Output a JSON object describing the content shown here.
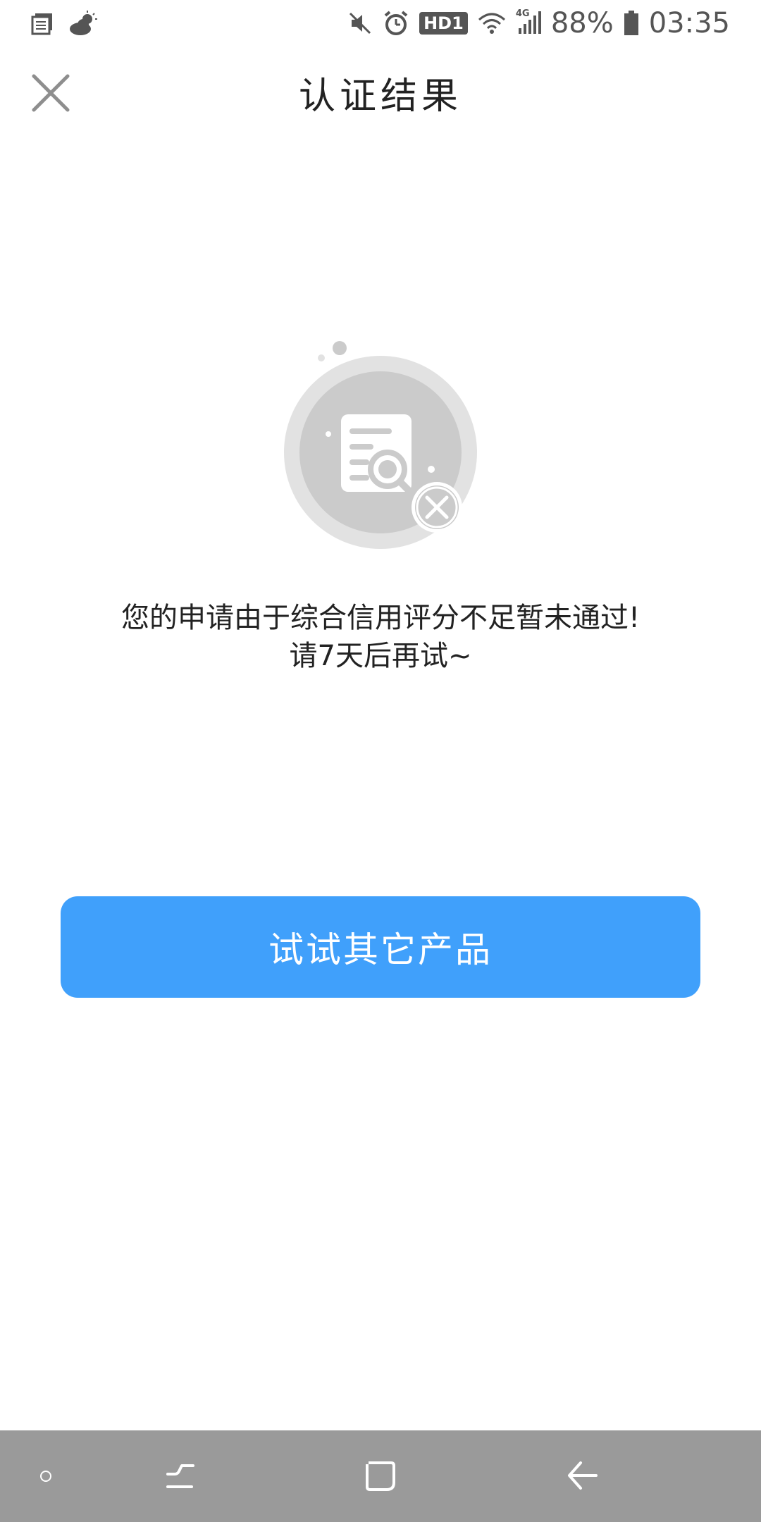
{
  "status_bar": {
    "battery": "88%",
    "time": "03:35",
    "network_badge": "HD1",
    "network_type": "4G",
    "icons": [
      "notes-icon",
      "weather-icon",
      "mute-icon",
      "alarm-icon",
      "hd-icon",
      "wifi-icon",
      "signal-icon",
      "battery-icon"
    ]
  },
  "header": {
    "title": "认证结果",
    "close_icon": "close-icon"
  },
  "result": {
    "illustration_icon": "document-search-failed-icon",
    "message_line1": "您的申请由于综合信用评分不足暂未通过!",
    "message_line2": "请7天后再试~"
  },
  "actions": {
    "primary_label": "试试其它产品"
  },
  "colors": {
    "accent": "#40a0fb",
    "illustration_gray": "#cccccc",
    "nav_bar": "#9a9a9a"
  },
  "nav_bar": {
    "icons": [
      "dot-icon",
      "recent-apps-icon",
      "home-icon",
      "back-icon"
    ]
  }
}
